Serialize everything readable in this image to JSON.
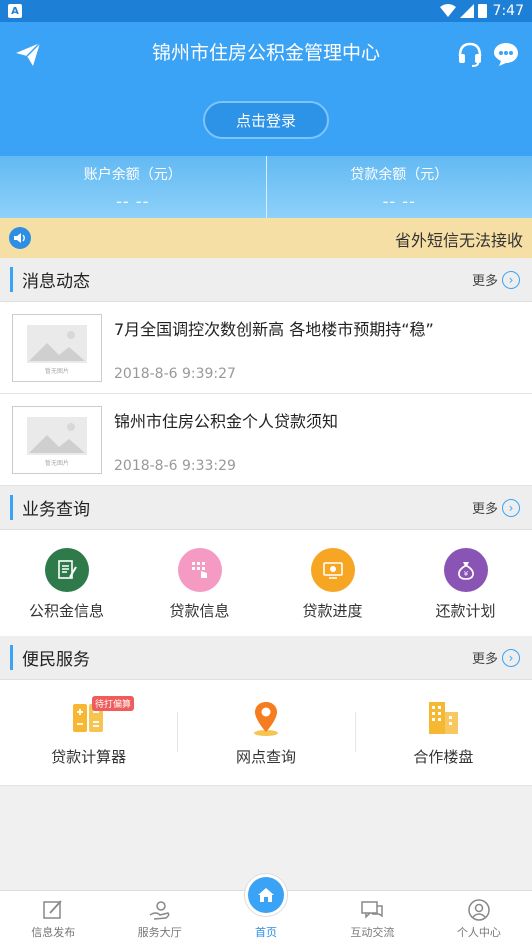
{
  "status_bar": {
    "badge": "A",
    "time": "7:47"
  },
  "header": {
    "title": "锦州市住房公积金管理中心",
    "login_label": "点击登录"
  },
  "balance": {
    "account_label": "账户余额（元）",
    "account_value": "-- --",
    "loan_label": "贷款余额（元）",
    "loan_value": "-- --"
  },
  "notice": {
    "text": "省外短信无法接收"
  },
  "news_section": {
    "title": "消息动态",
    "more": "更多",
    "items": [
      {
        "title": "7月全国调控次数创新高 各地楼市预期持“稳”",
        "date": "2018-8-6 9:39:27",
        "thumb_text": "暂无图片"
      },
      {
        "title": "锦州市住房公积金个人贷款须知",
        "date": "2018-8-6 9:33:29",
        "thumb_text": "暂无图片"
      }
    ]
  },
  "business_section": {
    "title": "业务查询",
    "more": "更多",
    "items": [
      {
        "label": "公积金信息",
        "color": "#2f7a4b",
        "icon": "document-icon"
      },
      {
        "label": "贷款信息",
        "color": "#f59ac3",
        "icon": "keypad-icon"
      },
      {
        "label": "贷款进度",
        "color": "#f6a623",
        "icon": "monitor-icon"
      },
      {
        "label": "还款计划",
        "color": "#8a54b5",
        "icon": "moneybag-icon"
      }
    ]
  },
  "service_section": {
    "title": "便民服务",
    "more": "更多",
    "items": [
      {
        "label": "贷款计算器",
        "icon": "calculator-icon",
        "tag": "待打偏算"
      },
      {
        "label": "网点查询",
        "icon": "location-pin-icon"
      },
      {
        "label": "合作楼盘",
        "icon": "building-icon"
      }
    ]
  },
  "tabbar": {
    "items": [
      {
        "label": "信息发布"
      },
      {
        "label": "服务大厅"
      },
      {
        "label": "首页"
      },
      {
        "label": "互动交流"
      },
      {
        "label": "个人中心"
      }
    ]
  },
  "colors": {
    "primary": "#3aa3f5",
    "notice_bg": "#f6dfa4"
  }
}
